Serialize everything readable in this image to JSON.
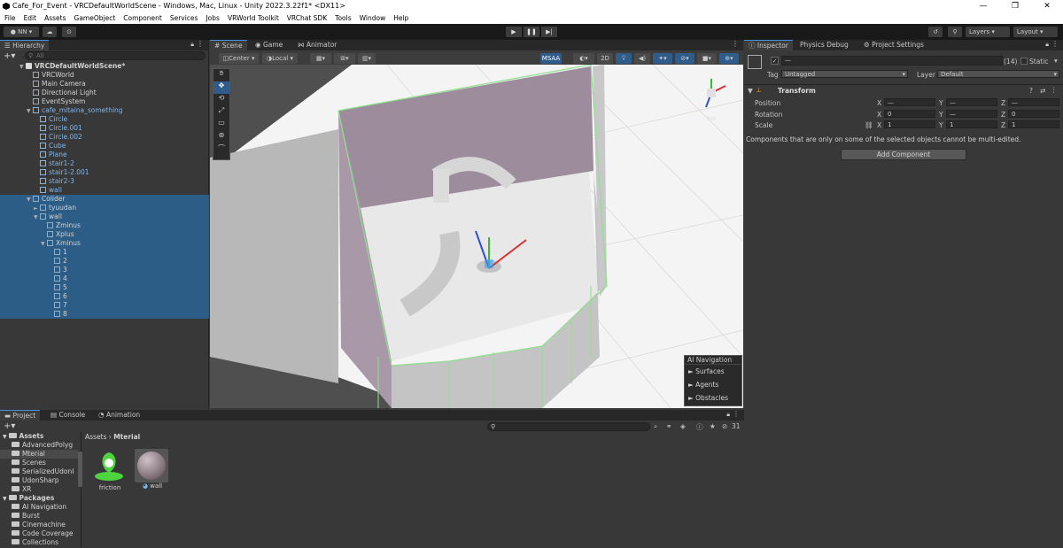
{
  "window": {
    "title": "Cafe_For_Event - VRCDefaultWorldScene - Windows, Mac, Linux - Unity 2022.3.22f1* <DX11>",
    "minimize": "—",
    "maximize": "❐",
    "close": "✕"
  },
  "menu": [
    "File",
    "Edit",
    "Assets",
    "GameObject",
    "Component",
    "Services",
    "Jobs",
    "VRWorld Toolkit",
    "VRChat SDK",
    "Tools",
    "Window",
    "Help"
  ],
  "toolbar": {
    "account": "NN ▾",
    "layers": "Layers",
    "layout": "Layout"
  },
  "hierarchy": {
    "tab": "Hierarchy",
    "search_placeholder": "All",
    "rows": [
      {
        "label": "VRCDefaultWorldScene*",
        "indent": 0,
        "arrow": "▼",
        "bold": true,
        "blue": false,
        "sel": false,
        "icon": "unity-icon"
      },
      {
        "label": "VRCWorld",
        "indent": 1,
        "arrow": "",
        "bold": false,
        "blue": false,
        "sel": false,
        "icon": "cube-icon"
      },
      {
        "label": "Main Camera",
        "indent": 1,
        "arrow": "",
        "bold": false,
        "blue": false,
        "sel": false,
        "icon": "cube-icon"
      },
      {
        "label": "Directional Light",
        "indent": 1,
        "arrow": "",
        "bold": false,
        "blue": false,
        "sel": false,
        "icon": "cube-icon"
      },
      {
        "label": "EventSystem",
        "indent": 1,
        "arrow": "",
        "bold": false,
        "blue": false,
        "sel": false,
        "icon": "cube-icon"
      },
      {
        "label": "cafe_mitaina_something",
        "indent": 1,
        "arrow": "▼",
        "bold": false,
        "blue": true,
        "sel": false,
        "icon": "cube-icon"
      },
      {
        "label": "Circle",
        "indent": 2,
        "arrow": "",
        "bold": false,
        "blue": true,
        "sel": false,
        "icon": "cube-icon"
      },
      {
        "label": "Circle.001",
        "indent": 2,
        "arrow": "",
        "bold": false,
        "blue": true,
        "sel": false,
        "icon": "cube-icon"
      },
      {
        "label": "Circle.002",
        "indent": 2,
        "arrow": "",
        "bold": false,
        "blue": true,
        "sel": false,
        "icon": "cube-icon"
      },
      {
        "label": "Cube",
        "indent": 2,
        "arrow": "",
        "bold": false,
        "blue": true,
        "sel": false,
        "icon": "cube-icon"
      },
      {
        "label": "Plane",
        "indent": 2,
        "arrow": "",
        "bold": false,
        "blue": true,
        "sel": false,
        "icon": "cube-icon"
      },
      {
        "label": "stair1-2",
        "indent": 2,
        "arrow": "",
        "bold": false,
        "blue": true,
        "sel": false,
        "icon": "cube-icon"
      },
      {
        "label": "stair1-2.001",
        "indent": 2,
        "arrow": "",
        "bold": false,
        "blue": true,
        "sel": false,
        "icon": "cube-icon"
      },
      {
        "label": "stair2-3",
        "indent": 2,
        "arrow": "",
        "bold": false,
        "blue": true,
        "sel": false,
        "icon": "cube-icon"
      },
      {
        "label": "wall",
        "indent": 2,
        "arrow": "",
        "bold": false,
        "blue": true,
        "sel": false,
        "icon": "cube-icon"
      },
      {
        "label": "Colider",
        "indent": 1,
        "arrow": "▼",
        "bold": false,
        "blue": false,
        "sel": true,
        "icon": "cube-icon"
      },
      {
        "label": "tyuudan",
        "indent": 2,
        "arrow": "►",
        "bold": false,
        "blue": false,
        "sel": true,
        "icon": "cube-icon"
      },
      {
        "label": "wall",
        "indent": 2,
        "arrow": "▼",
        "bold": false,
        "blue": false,
        "sel": true,
        "icon": "cube-icon"
      },
      {
        "label": "Zminus",
        "indent": 3,
        "arrow": "",
        "bold": false,
        "blue": false,
        "sel": true,
        "icon": "cube-icon"
      },
      {
        "label": "Xplus",
        "indent": 3,
        "arrow": "",
        "bold": false,
        "blue": false,
        "sel": true,
        "icon": "cube-icon"
      },
      {
        "label": "Xminus",
        "indent": 3,
        "arrow": "▼",
        "bold": false,
        "blue": false,
        "sel": true,
        "icon": "cube-icon"
      },
      {
        "label": "1",
        "indent": 4,
        "arrow": "",
        "bold": false,
        "blue": false,
        "sel": true,
        "icon": "cube-icon"
      },
      {
        "label": "2",
        "indent": 4,
        "arrow": "",
        "bold": false,
        "blue": false,
        "sel": true,
        "icon": "cube-icon"
      },
      {
        "label": "3",
        "indent": 4,
        "arrow": "",
        "bold": false,
        "blue": false,
        "sel": true,
        "icon": "cube-icon"
      },
      {
        "label": "4",
        "indent": 4,
        "arrow": "",
        "bold": false,
        "blue": false,
        "sel": true,
        "icon": "cube-icon"
      },
      {
        "label": "5",
        "indent": 4,
        "arrow": "",
        "bold": false,
        "blue": false,
        "sel": true,
        "icon": "cube-icon"
      },
      {
        "label": "6",
        "indent": 4,
        "arrow": "",
        "bold": false,
        "blue": false,
        "sel": true,
        "icon": "cube-icon"
      },
      {
        "label": "7",
        "indent": 4,
        "arrow": "",
        "bold": false,
        "blue": false,
        "sel": true,
        "icon": "cube-icon"
      },
      {
        "label": "8",
        "indent": 4,
        "arrow": "",
        "bold": false,
        "blue": false,
        "sel": true,
        "icon": "cube-icon"
      }
    ]
  },
  "scene": {
    "tabs": [
      "Scene",
      "Game",
      "Animator"
    ],
    "pivot": "Center",
    "space": "Local",
    "msaa": "MSAA",
    "mode2d": "2D",
    "iso": "Iso",
    "ai_nav": {
      "title": "AI Navigation",
      "items": [
        "Surfaces",
        "Agents",
        "Obstacles"
      ]
    }
  },
  "inspector": {
    "tabs": [
      "Inspector",
      "Physics Debug",
      "Project Settings"
    ],
    "name_value": "—",
    "count": "(14)",
    "static_label": "Static",
    "tag_label": "Tag",
    "tag_value": "Untagged",
    "layer_label": "Layer",
    "layer_value": "Default",
    "transform": "Transform",
    "position": {
      "label": "Position",
      "x": "—",
      "y": "—",
      "z": "—"
    },
    "rotation": {
      "label": "Rotation",
      "x": "0",
      "y": "—",
      "z": "0"
    },
    "scale": {
      "label": "Scale",
      "x": "1",
      "y": "1",
      "z": "1"
    },
    "axes": {
      "x": "X",
      "y": "Y",
      "z": "Z"
    },
    "multi_note": "Components that are only on some of the selected objects cannot be multi-edited.",
    "add_component": "Add Component"
  },
  "bottom": {
    "tabs": [
      "Project",
      "Console",
      "Animation"
    ],
    "count": "31",
    "tree": [
      {
        "label": "Assets",
        "indent": 0,
        "header": true
      },
      {
        "label": "AdvancedPolyg",
        "indent": 1,
        "header": false
      },
      {
        "label": "Mterial",
        "indent": 1,
        "header": false
      },
      {
        "label": "Scenes",
        "indent": 1,
        "header": false
      },
      {
        "label": "SerializedUdonI",
        "indent": 1,
        "header": false
      },
      {
        "label": "UdonSharp",
        "indent": 1,
        "header": false
      },
      {
        "label": "XR",
        "indent": 1,
        "header": false
      },
      {
        "label": "Packages",
        "indent": 0,
        "header": true
      },
      {
        "label": "AI Navigation",
        "indent": 1,
        "header": false
      },
      {
        "label": "Burst",
        "indent": 1,
        "header": false
      },
      {
        "label": "Cinemachine",
        "indent": 1,
        "header": false
      },
      {
        "label": "Code Coverage",
        "indent": 1,
        "header": false
      },
      {
        "label": "Collections",
        "indent": 1,
        "header": false
      }
    ],
    "breadcrumb": [
      "Assets",
      "Mterial"
    ],
    "assets": [
      {
        "label": "friction",
        "icon": "physic-material-icon"
      },
      {
        "label": "wall",
        "icon": "material-sphere-icon"
      }
    ]
  }
}
